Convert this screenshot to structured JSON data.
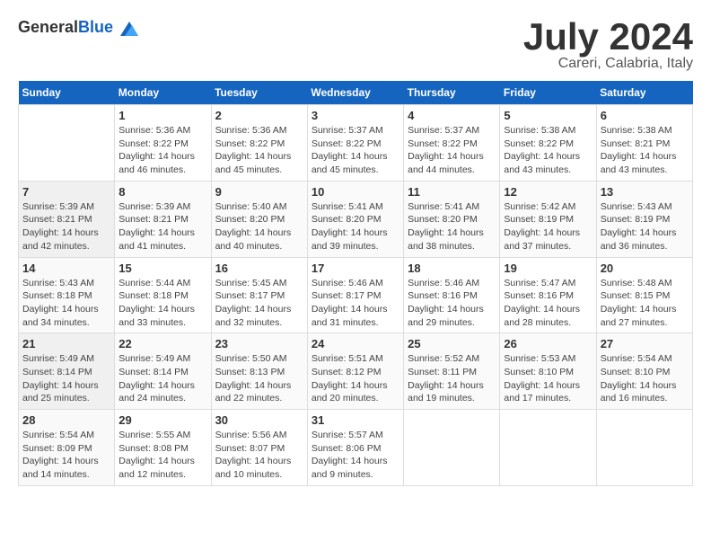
{
  "header": {
    "logo_general": "General",
    "logo_blue": "Blue",
    "month": "July 2024",
    "location": "Careri, Calabria, Italy"
  },
  "weekdays": [
    "Sunday",
    "Monday",
    "Tuesday",
    "Wednesday",
    "Thursday",
    "Friday",
    "Saturday"
  ],
  "weeks": [
    [
      {
        "day": "",
        "info": ""
      },
      {
        "day": "1",
        "info": "Sunrise: 5:36 AM\nSunset: 8:22 PM\nDaylight: 14 hours\nand 46 minutes."
      },
      {
        "day": "2",
        "info": "Sunrise: 5:36 AM\nSunset: 8:22 PM\nDaylight: 14 hours\nand 45 minutes."
      },
      {
        "day": "3",
        "info": "Sunrise: 5:37 AM\nSunset: 8:22 PM\nDaylight: 14 hours\nand 45 minutes."
      },
      {
        "day": "4",
        "info": "Sunrise: 5:37 AM\nSunset: 8:22 PM\nDaylight: 14 hours\nand 44 minutes."
      },
      {
        "day": "5",
        "info": "Sunrise: 5:38 AM\nSunset: 8:22 PM\nDaylight: 14 hours\nand 43 minutes."
      },
      {
        "day": "6",
        "info": "Sunrise: 5:38 AM\nSunset: 8:21 PM\nDaylight: 14 hours\nand 43 minutes."
      }
    ],
    [
      {
        "day": "7",
        "info": "Sunrise: 5:39 AM\nSunset: 8:21 PM\nDaylight: 14 hours\nand 42 minutes."
      },
      {
        "day": "8",
        "info": "Sunrise: 5:39 AM\nSunset: 8:21 PM\nDaylight: 14 hours\nand 41 minutes."
      },
      {
        "day": "9",
        "info": "Sunrise: 5:40 AM\nSunset: 8:20 PM\nDaylight: 14 hours\nand 40 minutes."
      },
      {
        "day": "10",
        "info": "Sunrise: 5:41 AM\nSunset: 8:20 PM\nDaylight: 14 hours\nand 39 minutes."
      },
      {
        "day": "11",
        "info": "Sunrise: 5:41 AM\nSunset: 8:20 PM\nDaylight: 14 hours\nand 38 minutes."
      },
      {
        "day": "12",
        "info": "Sunrise: 5:42 AM\nSunset: 8:19 PM\nDaylight: 14 hours\nand 37 minutes."
      },
      {
        "day": "13",
        "info": "Sunrise: 5:43 AM\nSunset: 8:19 PM\nDaylight: 14 hours\nand 36 minutes."
      }
    ],
    [
      {
        "day": "14",
        "info": "Sunrise: 5:43 AM\nSunset: 8:18 PM\nDaylight: 14 hours\nand 34 minutes."
      },
      {
        "day": "15",
        "info": "Sunrise: 5:44 AM\nSunset: 8:18 PM\nDaylight: 14 hours\nand 33 minutes."
      },
      {
        "day": "16",
        "info": "Sunrise: 5:45 AM\nSunset: 8:17 PM\nDaylight: 14 hours\nand 32 minutes."
      },
      {
        "day": "17",
        "info": "Sunrise: 5:46 AM\nSunset: 8:17 PM\nDaylight: 14 hours\nand 31 minutes."
      },
      {
        "day": "18",
        "info": "Sunrise: 5:46 AM\nSunset: 8:16 PM\nDaylight: 14 hours\nand 29 minutes."
      },
      {
        "day": "19",
        "info": "Sunrise: 5:47 AM\nSunset: 8:16 PM\nDaylight: 14 hours\nand 28 minutes."
      },
      {
        "day": "20",
        "info": "Sunrise: 5:48 AM\nSunset: 8:15 PM\nDaylight: 14 hours\nand 27 minutes."
      }
    ],
    [
      {
        "day": "21",
        "info": "Sunrise: 5:49 AM\nSunset: 8:14 PM\nDaylight: 14 hours\nand 25 minutes."
      },
      {
        "day": "22",
        "info": "Sunrise: 5:49 AM\nSunset: 8:14 PM\nDaylight: 14 hours\nand 24 minutes."
      },
      {
        "day": "23",
        "info": "Sunrise: 5:50 AM\nSunset: 8:13 PM\nDaylight: 14 hours\nand 22 minutes."
      },
      {
        "day": "24",
        "info": "Sunrise: 5:51 AM\nSunset: 8:12 PM\nDaylight: 14 hours\nand 20 minutes."
      },
      {
        "day": "25",
        "info": "Sunrise: 5:52 AM\nSunset: 8:11 PM\nDaylight: 14 hours\nand 19 minutes."
      },
      {
        "day": "26",
        "info": "Sunrise: 5:53 AM\nSunset: 8:10 PM\nDaylight: 14 hours\nand 17 minutes."
      },
      {
        "day": "27",
        "info": "Sunrise: 5:54 AM\nSunset: 8:10 PM\nDaylight: 14 hours\nand 16 minutes."
      }
    ],
    [
      {
        "day": "28",
        "info": "Sunrise: 5:54 AM\nSunset: 8:09 PM\nDaylight: 14 hours\nand 14 minutes."
      },
      {
        "day": "29",
        "info": "Sunrise: 5:55 AM\nSunset: 8:08 PM\nDaylight: 14 hours\nand 12 minutes."
      },
      {
        "day": "30",
        "info": "Sunrise: 5:56 AM\nSunset: 8:07 PM\nDaylight: 14 hours\nand 10 minutes."
      },
      {
        "day": "31",
        "info": "Sunrise: 5:57 AM\nSunset: 8:06 PM\nDaylight: 14 hours\nand 9 minutes."
      },
      {
        "day": "",
        "info": ""
      },
      {
        "day": "",
        "info": ""
      },
      {
        "day": "",
        "info": ""
      }
    ]
  ]
}
